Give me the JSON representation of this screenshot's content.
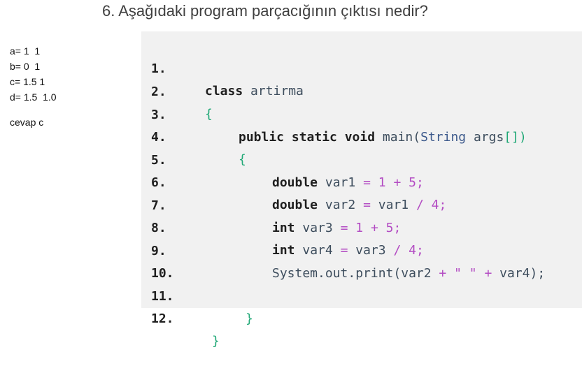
{
  "question": {
    "title": "6. Aşağıdaki program parçacığının çıktısı nedir?"
  },
  "answers": {
    "a": "a= 1  1",
    "b": "b= 0  1",
    "c": "c= 1.5 1",
    "d": "d= 1.5  1.0",
    "result": "cevap c"
  },
  "code": {
    "lines": [
      {
        "no": "1.",
        "tokens": [
          "class",
          "artirma"
        ]
      },
      {
        "no": "2.",
        "tokens": [
          "{"
        ]
      },
      {
        "no": "3.",
        "tokens": [
          "public static void",
          "main(",
          "String",
          "args",
          "[])"
        ]
      },
      {
        "no": "4.",
        "tokens": [
          "{"
        ]
      },
      {
        "no": "5.",
        "tokens": [
          "double",
          "var1",
          "=",
          "1",
          "+",
          "5",
          ";"
        ]
      },
      {
        "no": "6.",
        "tokens": [
          "double",
          "var2",
          "=",
          "var1",
          "/",
          "4",
          ";"
        ]
      },
      {
        "no": "7.",
        "tokens": [
          "int",
          "var3",
          "=",
          "1",
          "+",
          "5",
          ";"
        ]
      },
      {
        "no": "8.",
        "tokens": [
          "int",
          "var4",
          "=",
          "var3",
          "/",
          "4",
          ";"
        ]
      },
      {
        "no": "9.",
        "tokens": [
          "System.out.print(var2",
          "+",
          "\" \"",
          "+",
          "var4);"
        ]
      },
      {
        "no": "10.",
        "tokens": []
      },
      {
        "no": "11.",
        "tokens": [
          "}"
        ]
      },
      {
        "no": "12.",
        "tokens": [
          "}"
        ]
      }
    ]
  }
}
